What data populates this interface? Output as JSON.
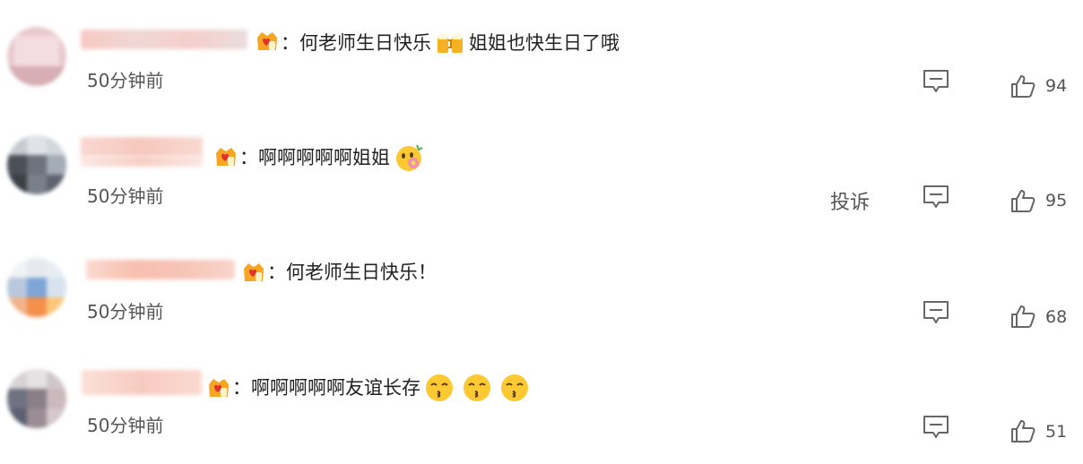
{
  "comments": [
    {
      "text_before": "：何老师生日快乐",
      "emoji_1": "beer-cheers-emoji",
      "text_after": "姐姐也快生日了哦",
      "time": "50分钟前",
      "likes": "94"
    },
    {
      "text_before": "：啊啊啊啊啊姐姐",
      "emoji_1": "flower-face-emoji",
      "time": "50分钟前",
      "report": "投诉",
      "likes": "95"
    },
    {
      "text_before": "：何老师生日快乐！",
      "time": "50分钟前",
      "likes": "68"
    },
    {
      "text_before": "：啊啊啊啊啊友谊长存",
      "emoji_1": "kissing-face-emoji",
      "time": "50分钟前",
      "likes": "51"
    }
  ],
  "colors": {
    "text": "#222222",
    "meta": "#555555",
    "badge": "#f6a623",
    "badge_heart": "#e2302d",
    "emoji_yellow": "#fcc933"
  }
}
